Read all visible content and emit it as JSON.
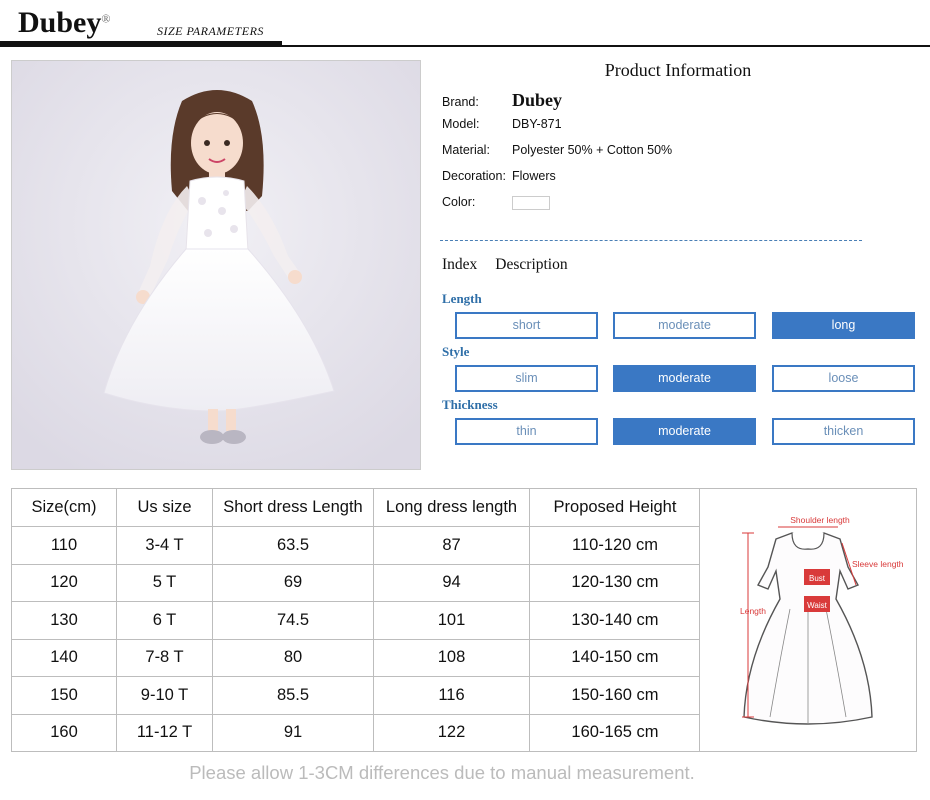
{
  "header": {
    "logo": "Dubey",
    "size_parameters": "SIZE PARAMETERS"
  },
  "product": {
    "title": "Product Information",
    "brand_label": "Brand:",
    "brand_value": "Dubey",
    "model_label": "Model:",
    "model_value": "DBY-871",
    "material_label": "Material:",
    "material_value": "Polyester 50% + Cotton 50%",
    "decoration_label": "Decoration:",
    "decoration_value": "Flowers",
    "color_label": "Color:"
  },
  "index": {
    "index_label": "Index",
    "description_label": "Description"
  },
  "attributes": [
    {
      "name": "Length",
      "options": [
        "short",
        "moderate",
        "long"
      ],
      "selected": "long"
    },
    {
      "name": "Style",
      "options": [
        "slim",
        "moderate",
        "loose"
      ],
      "selected": "moderate"
    },
    {
      "name": "Thickness",
      "options": [
        "thin",
        "moderate",
        "thicken"
      ],
      "selected": "moderate"
    }
  ],
  "size_table": {
    "headers": [
      "Size(cm)",
      "Us size",
      "Short dress Length",
      "Long dress length",
      "Proposed Height"
    ],
    "rows": [
      [
        "110",
        "3-4 T",
        "63.5",
        "87",
        "110-120 cm"
      ],
      [
        "120",
        "5 T",
        "69",
        "94",
        "120-130 cm"
      ],
      [
        "130",
        "6 T",
        "74.5",
        "101",
        "130-140 cm"
      ],
      [
        "140",
        "7-8 T",
        "80",
        "108",
        "140-150 cm"
      ],
      [
        "150",
        "9-10 T",
        "85.5",
        "116",
        "150-160 cm"
      ],
      [
        "160",
        "11-12 T",
        "91",
        "122",
        "160-165 cm"
      ]
    ]
  },
  "diagram": {
    "shoulder": "Shoulder length",
    "sleeve": "Sleeve length",
    "bust": "Bust",
    "waist": "Waist",
    "length": "Length"
  },
  "note": "Please allow 1-3CM differences due to manual measurement.",
  "colors": {
    "accent": "#3a78c4",
    "label_blue": "#2f6fa8",
    "note_gray": "#bbbbbb",
    "diagram_red": "#d93a3a"
  }
}
